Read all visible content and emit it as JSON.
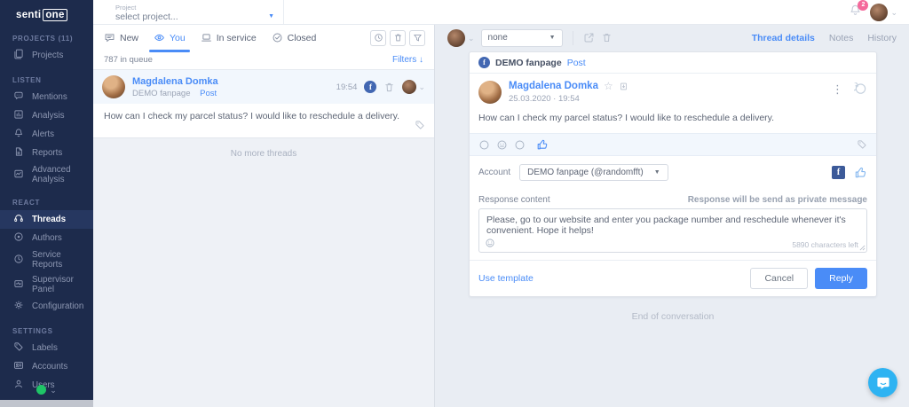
{
  "colors": {
    "accent_blue": "#4a8cf7",
    "sidebar_navy": "#1d2b4c",
    "facebook_blue": "#3c5a99",
    "chat_widget_blue": "#2eb3f2",
    "badge_pink": "#f4699b",
    "presence_green": "#1fc567"
  },
  "glyphs": {
    "caret_down_filled": "▼",
    "chevron_down": "⌄",
    "kebab": "⋮",
    "star": "☆",
    "arrow_down": "↓",
    "facebook_f": "f"
  },
  "brand": {
    "name_left": "senti",
    "name_boxed": "one"
  },
  "topbar": {
    "project_label": "Project",
    "project_value": "select project...",
    "notification_count": "2"
  },
  "sidebar": {
    "sections": [
      {
        "title": "PROJECTS (11)",
        "items": [
          {
            "label": "Projects",
            "icon": "projects-icon"
          }
        ]
      },
      {
        "title": "LISTEN",
        "items": [
          {
            "label": "Mentions",
            "icon": "mentions-icon"
          },
          {
            "label": "Analysis",
            "icon": "analysis-icon"
          },
          {
            "label": "Alerts",
            "icon": "alerts-icon"
          },
          {
            "label": "Reports",
            "icon": "reports-icon"
          },
          {
            "label": "Advanced Analysis",
            "icon": "advanced-analysis-icon"
          }
        ]
      },
      {
        "title": "REACT",
        "items": [
          {
            "label": "Threads",
            "icon": "threads-icon",
            "active": true
          },
          {
            "label": "Authors",
            "icon": "authors-icon"
          },
          {
            "label": "Service Reports",
            "icon": "service-reports-icon"
          },
          {
            "label": "Supervisor Panel",
            "icon": "supervisor-panel-icon"
          },
          {
            "label": "Configuration",
            "icon": "configuration-icon"
          }
        ]
      },
      {
        "title": "SETTINGS",
        "items": [
          {
            "label": "Labels",
            "icon": "labels-icon"
          },
          {
            "label": "Accounts",
            "icon": "accounts-icon"
          },
          {
            "label": "Users",
            "icon": "users-icon"
          }
        ]
      }
    ]
  },
  "threads_panel": {
    "tabs": [
      {
        "label": "New"
      },
      {
        "label": "You",
        "active": true
      },
      {
        "label": "In service"
      },
      {
        "label": "Closed"
      }
    ],
    "queue_count": "787 in queue",
    "filters_label": "Filters",
    "thread": {
      "author": "Magdalena Domka",
      "source": "DEMO fanpage",
      "post_type": "Post",
      "time": "19:54",
      "message": "How can I check my parcel status? I would like to reschedule a delivery."
    },
    "empty_label": "No more threads"
  },
  "conversation": {
    "assignee_value": "none",
    "nav": [
      {
        "label": "Thread details",
        "active": true
      },
      {
        "label": "Notes"
      },
      {
        "label": "History"
      }
    ],
    "card": {
      "page_name": "DEMO fanpage",
      "post_type": "Post",
      "author": "Magdalena Domka",
      "datetime": "25.03.2020  ·  19:54",
      "message": "How can I check my parcel status? I would like to reschedule a delivery.",
      "account_label": "Account",
      "account_value": "DEMO fanpage (@randomfft)",
      "response_label": "Response content",
      "response_hint": "Response will be send as private message",
      "response_text": "Please, go to our website and enter you package number and reschedule whenever it's convenient. Hope it helps!",
      "chars_left": "5890 characters left",
      "use_template_label": "Use template",
      "cancel_label": "Cancel",
      "reply_label": "Reply"
    },
    "end_label": "End of conversation"
  }
}
